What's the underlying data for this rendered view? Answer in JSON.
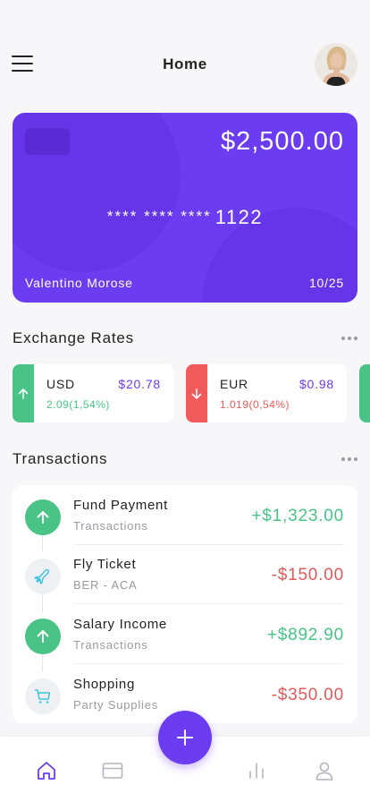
{
  "header": {
    "title": "Home"
  },
  "card": {
    "balance": "$2,500.00",
    "number_masked": "**** **** ****",
    "number_last": "1122",
    "holder": "Valentino Morose",
    "expiry": "10/25"
  },
  "exchange": {
    "title": "Exchange Rates",
    "rates": [
      {
        "code": "USD",
        "value": "$20.78",
        "change": "2.09(1,54%)",
        "direction": "up",
        "color": "#49c486"
      },
      {
        "code": "EUR",
        "value": "$0.98",
        "change": "1.019(0,54%)",
        "direction": "down",
        "color": "#f15a5a"
      }
    ]
  },
  "transactions": {
    "title": "Transactions",
    "items": [
      {
        "name": "Fund Payment",
        "sub": "Transactions",
        "amount": "+$1,323.00",
        "icon": "arrow-up-icon"
      },
      {
        "name": "Fly Ticket",
        "sub": "BER - ACA",
        "amount": "-$150.00",
        "icon": "plane-icon"
      },
      {
        "name": "Salary Income",
        "sub": "Transactions",
        "amount": "+$892.90",
        "icon": "arrow-up-icon"
      },
      {
        "name": "Shopping",
        "sub": "Party Supplies",
        "amount": "-$350.00",
        "icon": "cart-icon"
      }
    ]
  },
  "colors": {
    "accent": "#6c3cf0",
    "positive": "#49c486",
    "negative": "#e05a5a",
    "muted": "#9a9aa2"
  },
  "nav": {
    "items": [
      "home-icon",
      "card-icon",
      "add-icon",
      "chart-icon",
      "profile-icon"
    ]
  }
}
